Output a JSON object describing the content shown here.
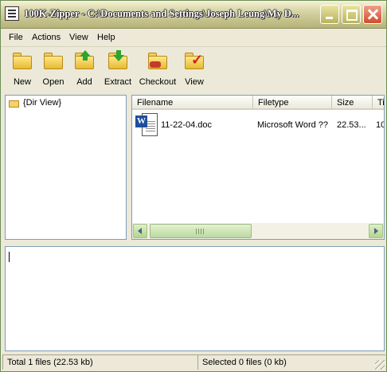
{
  "window": {
    "title": "100K-Zipper - C:\\Documents and Settings\\Joseph Leung\\My D..."
  },
  "menu": [
    "File",
    "Actions",
    "View",
    "Help"
  ],
  "toolbar": [
    {
      "label": "New",
      "icon": "folder-new-icon"
    },
    {
      "label": "Open",
      "icon": "folder-open-icon"
    },
    {
      "label": "Add",
      "icon": "add-arrow-icon"
    },
    {
      "label": "Extract",
      "icon": "extract-arrow-icon"
    },
    {
      "label": "Checkout",
      "icon": "checkout-icon"
    },
    {
      "label": "View",
      "icon": "view-check-icon"
    }
  ],
  "tree": {
    "root_label": "{Dir View}"
  },
  "filelist": {
    "columns": [
      "Filename",
      "Filetype",
      "Size",
      "Ti"
    ],
    "rows": [
      {
        "filename": "11-22-04.doc",
        "filetype": "Microsoft Word ??",
        "size": "22.53...",
        "time": "10"
      }
    ]
  },
  "status": {
    "total": "Total 1 files (22.53 kb)",
    "selected": "Selected 0 files (0 kb)"
  },
  "colors": {
    "title_bar": "#C5C28C",
    "close_button": "#D24A2A",
    "word_icon": "#1E4E9C"
  }
}
